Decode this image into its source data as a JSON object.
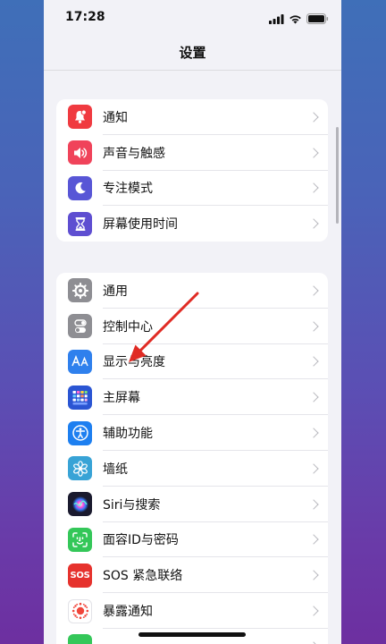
{
  "status_bar": {
    "time": "17:28"
  },
  "nav": {
    "title": "设置"
  },
  "groups": [
    {
      "items": [
        {
          "label": "通知",
          "icon": "bell-icon",
          "color": "#f03a40"
        },
        {
          "label": "声音与触感",
          "icon": "speaker-icon",
          "color": "#f0435a"
        },
        {
          "label": "专注模式",
          "icon": "moon-icon",
          "color": "#5856d6"
        },
        {
          "label": "屏幕使用时间",
          "icon": "hourglass-icon",
          "color": "#5e4ed1"
        }
      ]
    },
    {
      "items": [
        {
          "label": "通用",
          "icon": "gear-icon",
          "color": "#8e8e93"
        },
        {
          "label": "控制中心",
          "icon": "toggles-icon",
          "color": "#8e8e93"
        },
        {
          "label": "显示与亮度",
          "icon": "text-size-icon",
          "color": "#2f80ed"
        },
        {
          "label": "主屏幕",
          "icon": "grid-icon",
          "color": "#2a55d3"
        },
        {
          "label": "辅助功能",
          "icon": "accessibility-icon",
          "color": "#1d7ff0"
        },
        {
          "label": "墙纸",
          "icon": "flower-icon",
          "color": "#38a3d6"
        },
        {
          "label": "Siri与搜索",
          "icon": "siri-icon",
          "color": "#1a1a2e"
        },
        {
          "label": "面容ID与密码",
          "icon": "face-id-icon",
          "color": "#34c759"
        },
        {
          "label": "SOS 紧急联络",
          "icon": "sos-icon",
          "color": "#e6322d",
          "icon_text": "SOS"
        },
        {
          "label": "暴露通知",
          "icon": "exposure-icon",
          "color": "#ffffff"
        },
        {
          "label": "",
          "icon": "battery-icon",
          "color": "#34c759"
        }
      ]
    }
  ],
  "annotation": {
    "color": "#e02b24"
  }
}
